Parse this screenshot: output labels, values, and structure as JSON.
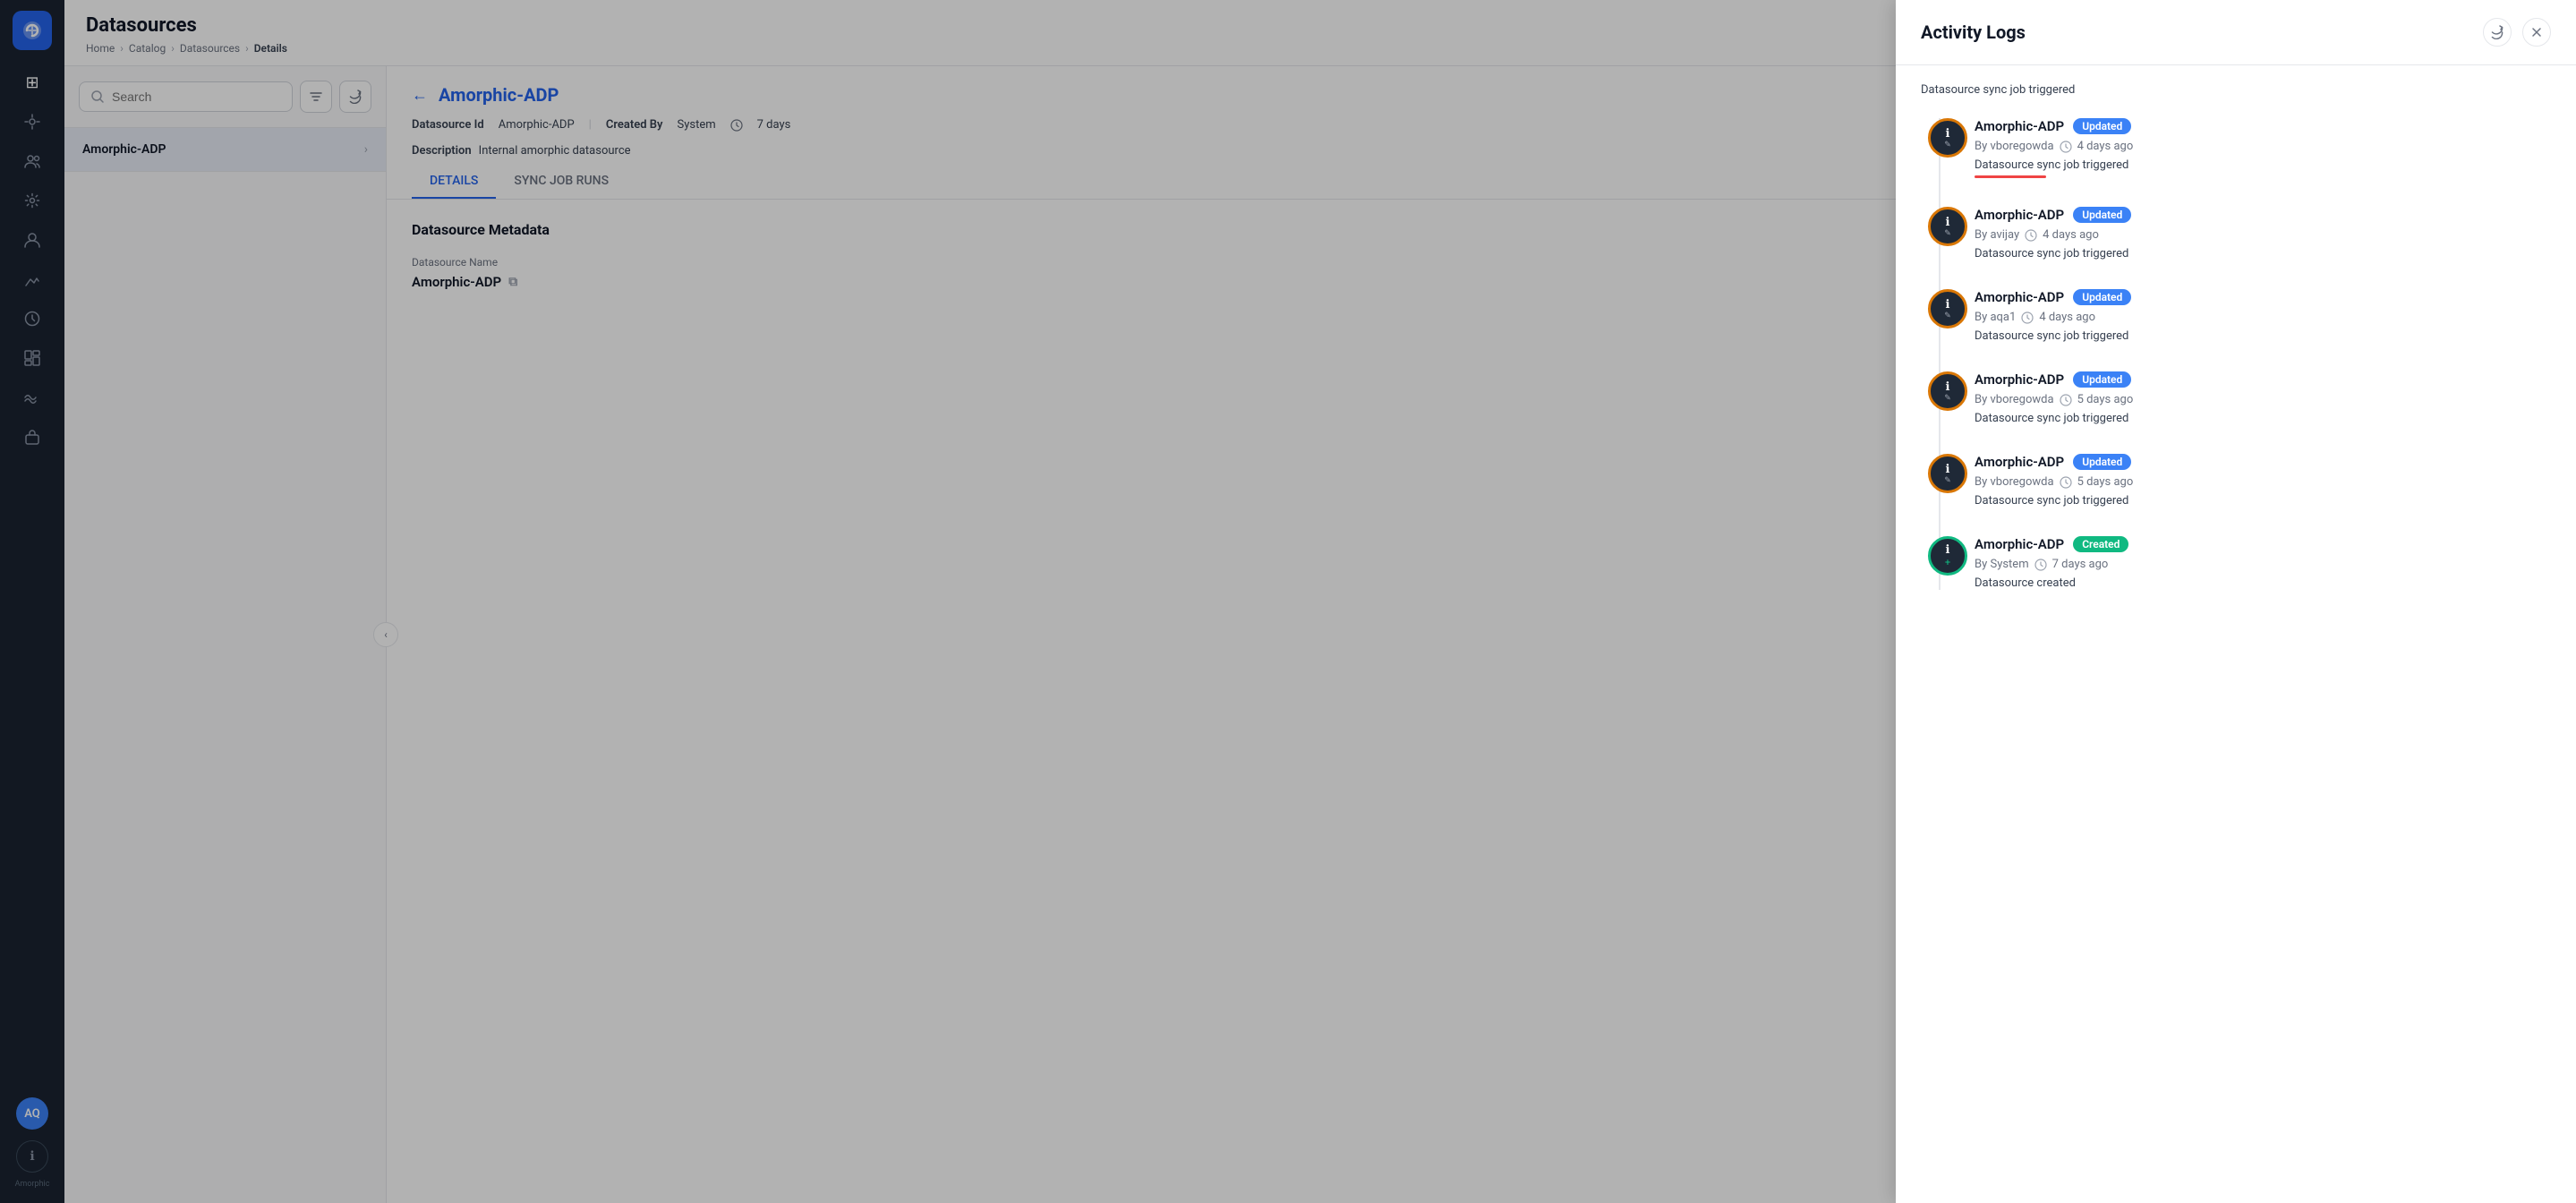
{
  "app": {
    "name": "Amorphic",
    "logo_text": "A"
  },
  "sidebar": {
    "items": [
      {
        "id": "home",
        "icon": "⊞",
        "label": "Home"
      },
      {
        "id": "filters",
        "icon": "⚡",
        "label": "Filters"
      },
      {
        "id": "users",
        "icon": "👥",
        "label": "Users"
      },
      {
        "id": "settings",
        "icon": "⚙",
        "label": "Settings"
      },
      {
        "id": "profile",
        "icon": "👤",
        "label": "Profile"
      },
      {
        "id": "activity",
        "icon": "↗",
        "label": "Activity"
      },
      {
        "id": "clock",
        "icon": "🕐",
        "label": "Clock"
      },
      {
        "id": "dashboard",
        "icon": "📊",
        "label": "Dashboard"
      },
      {
        "id": "waves",
        "icon": "〰",
        "label": "Waves"
      },
      {
        "id": "bag",
        "icon": "💼",
        "label": "Bag"
      }
    ],
    "avatar": "AQ",
    "info_icon": "ℹ",
    "brand": "Amorphic"
  },
  "header": {
    "title": "Datasources",
    "breadcrumbs": [
      "Home",
      "Catalog",
      "Datasources",
      "Details"
    ]
  },
  "search": {
    "placeholder": "Search"
  },
  "list": {
    "items": [
      {
        "id": "amorphic-adp",
        "name": "Amorphic-ADP",
        "active": true
      }
    ]
  },
  "detail": {
    "back_label": "←",
    "name": "Amorphic-ADP",
    "datasource_id_label": "Datasource Id",
    "datasource_id_value": "Amorphic-ADP",
    "created_by_label": "Created By",
    "created_by_value": "System",
    "created_time": "7 days",
    "description_label": "Description",
    "description_value": "Internal amorphic datasource",
    "tabs": [
      {
        "id": "details",
        "label": "DETAILS",
        "active": true
      },
      {
        "id": "sync-job-runs",
        "label": "SYNC JOB RUNS",
        "active": false
      }
    ],
    "section_title": "Datasource Metadata",
    "datasource_name_label": "Datasource Name",
    "datasource_name_value": "Amorphic-ADP"
  },
  "activity_logs": {
    "title": "Activity Logs",
    "intro_text": "Datasource sync job triggered",
    "entries": [
      {
        "id": 1,
        "name": "Amorphic-ADP",
        "badge": "Updated",
        "badge_type": "updated",
        "by": "vboregowda",
        "time": "4 days ago",
        "description": "Datasource sync job triggered",
        "has_red_underline": true
      },
      {
        "id": 2,
        "name": "Amorphic-ADP",
        "badge": "Updated",
        "badge_type": "updated",
        "by": "avijay",
        "time": "4 days ago",
        "description": "Datasource sync job triggered",
        "has_red_underline": false
      },
      {
        "id": 3,
        "name": "Amorphic-ADP",
        "badge": "Updated",
        "badge_type": "updated",
        "by": "aqa1",
        "time": "4 days ago",
        "description": "Datasource sync job triggered",
        "has_red_underline": false
      },
      {
        "id": 4,
        "name": "Amorphic-ADP",
        "badge": "Updated",
        "badge_type": "updated",
        "by": "vboregowda",
        "time": "5 days ago",
        "description": "Datasource sync job triggered",
        "has_red_underline": false
      },
      {
        "id": 5,
        "name": "Amorphic-ADP",
        "badge": "Updated",
        "badge_type": "updated",
        "by": "vboregowda",
        "time": "5 days ago",
        "description": "Datasource sync job triggered",
        "has_red_underline": false
      },
      {
        "id": 6,
        "name": "Amorphic-ADP",
        "badge": "Created",
        "badge_type": "created",
        "by": "System",
        "time": "7 days ago",
        "description": "Datasource created",
        "has_red_underline": false
      }
    ]
  }
}
